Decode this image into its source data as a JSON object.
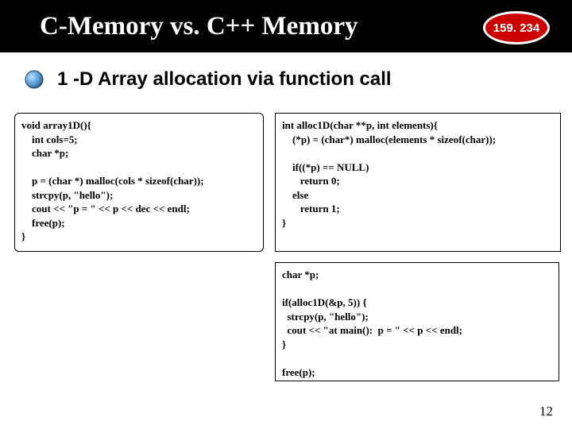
{
  "header": {
    "title": "C-Memory vs. C++ Memory",
    "badge": "159. 234"
  },
  "section": {
    "title": "1 -D Array allocation via function call"
  },
  "code": {
    "left": "void array1D(){\n    int cols=5;\n    char *p;\n\n    p = (char *) malloc(cols * sizeof(char));\n    strcpy(p, \"hello\");\n    cout << \"p = \" << p << dec << endl;\n    free(p);\n}",
    "right_top": "int alloc1D(char **p, int elements){\n    (*p) = (char*) malloc(elements * sizeof(char));\n\n    if((*p) == NULL)\n       return 0;\n    else\n       return 1;\n}",
    "right_bottom": "char *p;\n\nif(alloc1D(&p, 5)) {\n  strcpy(p, \"hello\");\n  cout << \"at main():  p = \" << p << endl;\n}\n\nfree(p);"
  },
  "page_number": "12"
}
